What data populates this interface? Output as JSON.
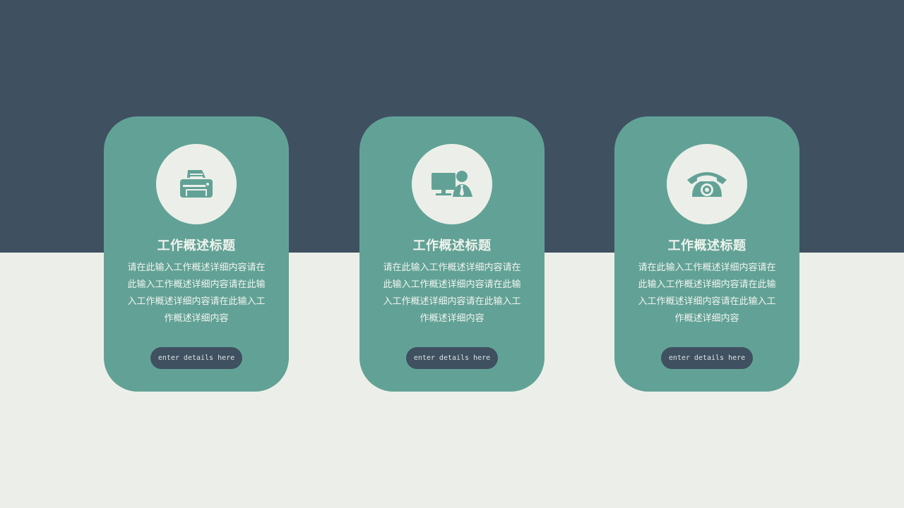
{
  "colors": {
    "top_band": "#3f5061",
    "background": "#ecefe9",
    "card": "#62a296",
    "icon_circle": "#ecefe9",
    "button": "#3f5061"
  },
  "cards": [
    {
      "icon": "printer-icon",
      "title": "工作概述标题",
      "body": "请在此输入工作概述详细内容请在此输入工作概述详细内容请在此输入工作概述详细内容请在此输入工作概述详细内容",
      "button_label": "enter details here"
    },
    {
      "icon": "computer-user-icon",
      "title": "工作概述标题",
      "body": "请在此输入工作概述详细内容请在此输入工作概述详细内容请在此输入工作概述详细内容请在此输入工作概述详细内容",
      "button_label": "enter details here"
    },
    {
      "icon": "telephone-icon",
      "title": "工作概述标题",
      "body": "请在此输入工作概述详细内容请在此输入工作概述详细内容请在此输入工作概述详细内容请在此输入工作概述详细内容",
      "button_label": "enter details here"
    }
  ]
}
